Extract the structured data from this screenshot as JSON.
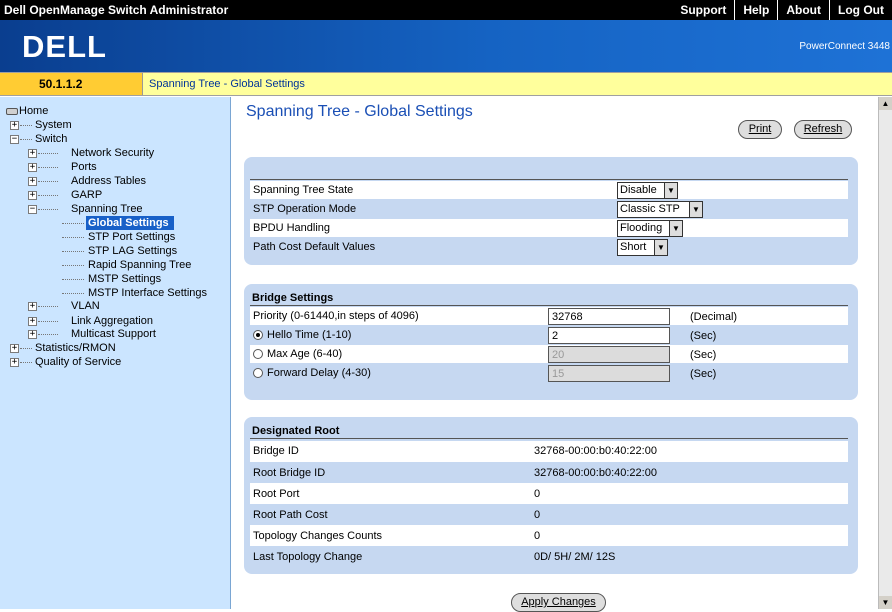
{
  "app_title": "Dell OpenManage Switch Administrator",
  "top_nav": [
    "Support",
    "Help",
    "About",
    "Log Out"
  ],
  "brand": {
    "logo": "DELL",
    "product": "PowerConnect 3448"
  },
  "address": {
    "ip": "50.1.1.2",
    "breadcrumb": "Spanning Tree - Global Settings"
  },
  "tree": [
    "Home",
    "System",
    "Switch",
    "Network Security",
    "Ports",
    "Address Tables",
    "GARP",
    "Spanning Tree",
    "Global Settings",
    "STP Port Settings",
    "STP LAG Settings",
    "Rapid Spanning Tree",
    "MSTP Settings",
    "MSTP Interface Settings",
    "VLAN",
    "Link Aggregation",
    "Multicast Support",
    "Statistics/RMON",
    "Quality of Service"
  ],
  "page": {
    "title": "Spanning Tree - Global Settings",
    "print": "Print",
    "refresh": "Refresh",
    "apply": "Apply Changes"
  },
  "global": {
    "rows": [
      {
        "label": "Spanning Tree State",
        "value": "Disable"
      },
      {
        "label": "STP Operation Mode",
        "value": "Classic STP"
      },
      {
        "label": "BPDU Handling",
        "value": "Flooding"
      },
      {
        "label": "Path Cost Default Values",
        "value": "Short"
      }
    ]
  },
  "bridge": {
    "heading": "Bridge Settings",
    "priority": {
      "label": "Priority  (0-61440,in steps of 4096)",
      "value": "32768",
      "unit": "(Decimal)"
    },
    "hello": {
      "label": "Hello Time  (1-10)",
      "value": "2",
      "unit": "(Sec)"
    },
    "maxage": {
      "label": "Max Age  (6-40)",
      "value": "20",
      "unit": "(Sec)"
    },
    "fwd": {
      "label": "Forward Delay  (4-30)",
      "value": "15",
      "unit": "(Sec)"
    }
  },
  "designated": {
    "heading": "Designated Root",
    "rows": [
      {
        "label": "Bridge ID",
        "value": "32768-00:00:b0:40:22:00"
      },
      {
        "label": "Root Bridge ID",
        "value": "32768-00:00:b0:40:22:00"
      },
      {
        "label": "Root Port",
        "value": "0"
      },
      {
        "label": "Root Path Cost",
        "value": "0"
      },
      {
        "label": "Topology Changes Counts",
        "value": "0"
      },
      {
        "label": "Last Topology Change",
        "value": "0D/ 5H/ 2M/ 12S"
      }
    ]
  }
}
